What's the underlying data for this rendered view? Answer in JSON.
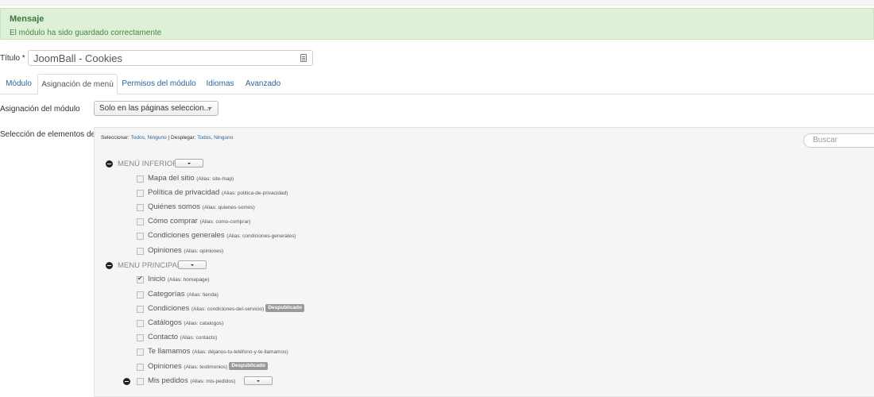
{
  "message": {
    "title": "Mensaje",
    "text": "El módulo ha sido guardado correctamente"
  },
  "title_field": {
    "label": "Título *",
    "value": "JoomBall - Cookies"
  },
  "tabs": [
    {
      "label": "Módulo",
      "active": false
    },
    {
      "label": "Asignación de menú",
      "active": true
    },
    {
      "label": "Permisos del módulo",
      "active": false
    },
    {
      "label": "Idiomas",
      "active": false
    },
    {
      "label": "Avanzado",
      "active": false
    }
  ],
  "assignment": {
    "label": "Asignación del módulo",
    "selected": "Solo en las páginas seleccion..."
  },
  "selection": {
    "label": "Selección de elementos del menú:",
    "select_prefix": "Seleccionar:",
    "select_all": "Todos",
    "select_none": "Ninguno",
    "separator": "|",
    "expand_prefix": "Desplegar:",
    "expand_all": "Todos",
    "expand_none": "Ninguno",
    "search_placeholder": "Buscar"
  },
  "menus": [
    {
      "title": "MENÚ INFERIOR",
      "items": [
        {
          "label": "Mapa del sitio",
          "alias": "(Alias: site-map)",
          "checked": false,
          "badge": ""
        },
        {
          "label": "Política de privacidad",
          "alias": "(Alias: politica-de-privacidad)",
          "checked": false,
          "badge": ""
        },
        {
          "label": "Quiénes somos",
          "alias": "(Alias: quienes-somos)",
          "checked": false,
          "badge": ""
        },
        {
          "label": "Cómo comprar",
          "alias": "(Alias: como-comprar)",
          "checked": false,
          "badge": ""
        },
        {
          "label": "Condiciones generales",
          "alias": "(Alias: condiciones-generales)",
          "checked": false,
          "badge": ""
        },
        {
          "label": "Opiniones",
          "alias": "(Alias: opiniones)",
          "checked": false,
          "badge": ""
        }
      ]
    },
    {
      "title": "MENU PRINCIPAL",
      "items": [
        {
          "label": "Inicio",
          "alias": "(Alias: homepage)",
          "checked": true,
          "badge": ""
        },
        {
          "label": "Categorías",
          "alias": "(Alias: tienda)",
          "checked": false,
          "badge": ""
        },
        {
          "label": "Condiciones",
          "alias": "(Alias: condiciones-del-servicio)",
          "checked": false,
          "badge": "Despublicado"
        },
        {
          "label": "Catálogos",
          "alias": "(Alias: catalogos)",
          "checked": false,
          "badge": ""
        },
        {
          "label": "Contacto",
          "alias": "(Alias: contacto)",
          "checked": false,
          "badge": ""
        },
        {
          "label": "Te llamamos",
          "alias": "(Alias: déjanos-tu-teléfono-y-te-llamamos)",
          "checked": false,
          "badge": ""
        },
        {
          "label": "Opiniones",
          "alias": "(Alias: testimonios)",
          "checked": false,
          "badge": "Despublicado"
        },
        {
          "label": "Mis pedidos",
          "alias": "(Alias: mis-pedidos)",
          "checked": false,
          "badge": ""
        }
      ]
    }
  ]
}
